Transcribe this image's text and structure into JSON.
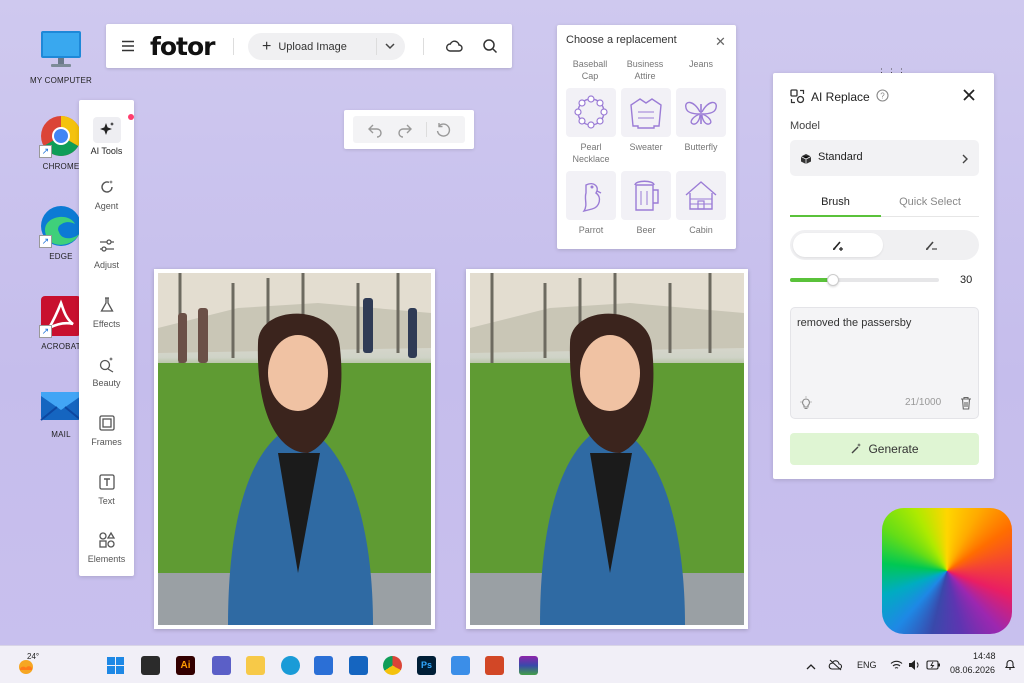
{
  "desktop": {
    "icons": [
      {
        "label": "MY COMPUTER"
      },
      {
        "label": "CHROME"
      },
      {
        "label": "EDGE"
      },
      {
        "label": "ACROBAT"
      },
      {
        "label": "MAIL"
      }
    ]
  },
  "topbar": {
    "logo": "fotor",
    "upload_label": "Upload Image"
  },
  "tools": [
    {
      "label": "AI Tools",
      "icon": "sparkle-icon"
    },
    {
      "label": "Agent",
      "icon": "agent-icon"
    },
    {
      "label": "Adjust",
      "icon": "sliders-icon"
    },
    {
      "label": "Effects",
      "icon": "flask-icon"
    },
    {
      "label": "Beauty",
      "icon": "beauty-icon"
    },
    {
      "label": "Frames",
      "icon": "frame-icon"
    },
    {
      "label": "Text",
      "icon": "text-icon"
    },
    {
      "label": "Elements",
      "icon": "shapes-icon"
    }
  ],
  "replacement": {
    "title": "Choose a replacement",
    "top_labels": [
      {
        "line1": "Baseball",
        "line2": "Cap"
      },
      {
        "line1": "Business",
        "line2": "Attire"
      },
      {
        "line1": "Jeans",
        "line2": ""
      }
    ],
    "items": [
      {
        "line1": "Pearl",
        "line2": "Necklace",
        "icon": "necklace-icon"
      },
      {
        "line1": "Sweater",
        "line2": "",
        "icon": "sweater-icon"
      },
      {
        "line1": "Butterfly",
        "line2": "",
        "icon": "butterfly-icon"
      },
      {
        "line1": "Parrot",
        "line2": "",
        "icon": "parrot-icon"
      },
      {
        "line1": "Beer",
        "line2": "",
        "icon": "beer-icon"
      },
      {
        "line1": "Cabin",
        "line2": "",
        "icon": "cabin-icon"
      }
    ]
  },
  "ai_panel": {
    "title": "AI Replace",
    "model_label": "Model",
    "model_value": "Standard",
    "tabs": [
      "Brush",
      "Quick Select"
    ],
    "active_tab": "Brush",
    "brush_size": "30",
    "brush_fraction": 0.29,
    "prompt": "removed the passersby",
    "char_count": "21/1000",
    "generate_label": "Generate"
  },
  "taskbar": {
    "weather_temp": "24°",
    "language": "ENG",
    "time": "14:48",
    "date": "08.06.2026"
  },
  "colors": {
    "accent_green": "#5ac23a",
    "generate_bg": "#dff5d3",
    "icon_purple": "#9b7cd6"
  }
}
